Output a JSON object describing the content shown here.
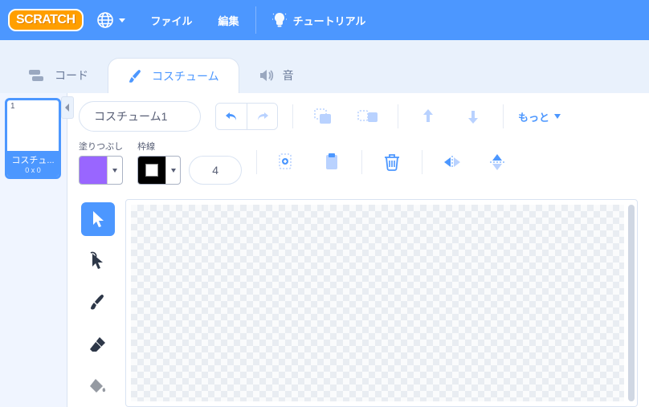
{
  "brand": "SCRATCH",
  "menu": {
    "file": "ファイル",
    "edit": "編集",
    "tutorials": "チュートリアル"
  },
  "tabs": {
    "code": "コード",
    "costumes": "コスチューム",
    "sounds": "音"
  },
  "costume_item": {
    "number": "1",
    "name": "コスチュ...",
    "size": "0 x 0"
  },
  "editor": {
    "costume_name": "コスチューム1",
    "more": "もっと",
    "fill_label": "塗りつぶし",
    "outline_label": "枠線",
    "outline_width": "4",
    "fill_color": "#9966ff",
    "outline_color": "#000000"
  }
}
